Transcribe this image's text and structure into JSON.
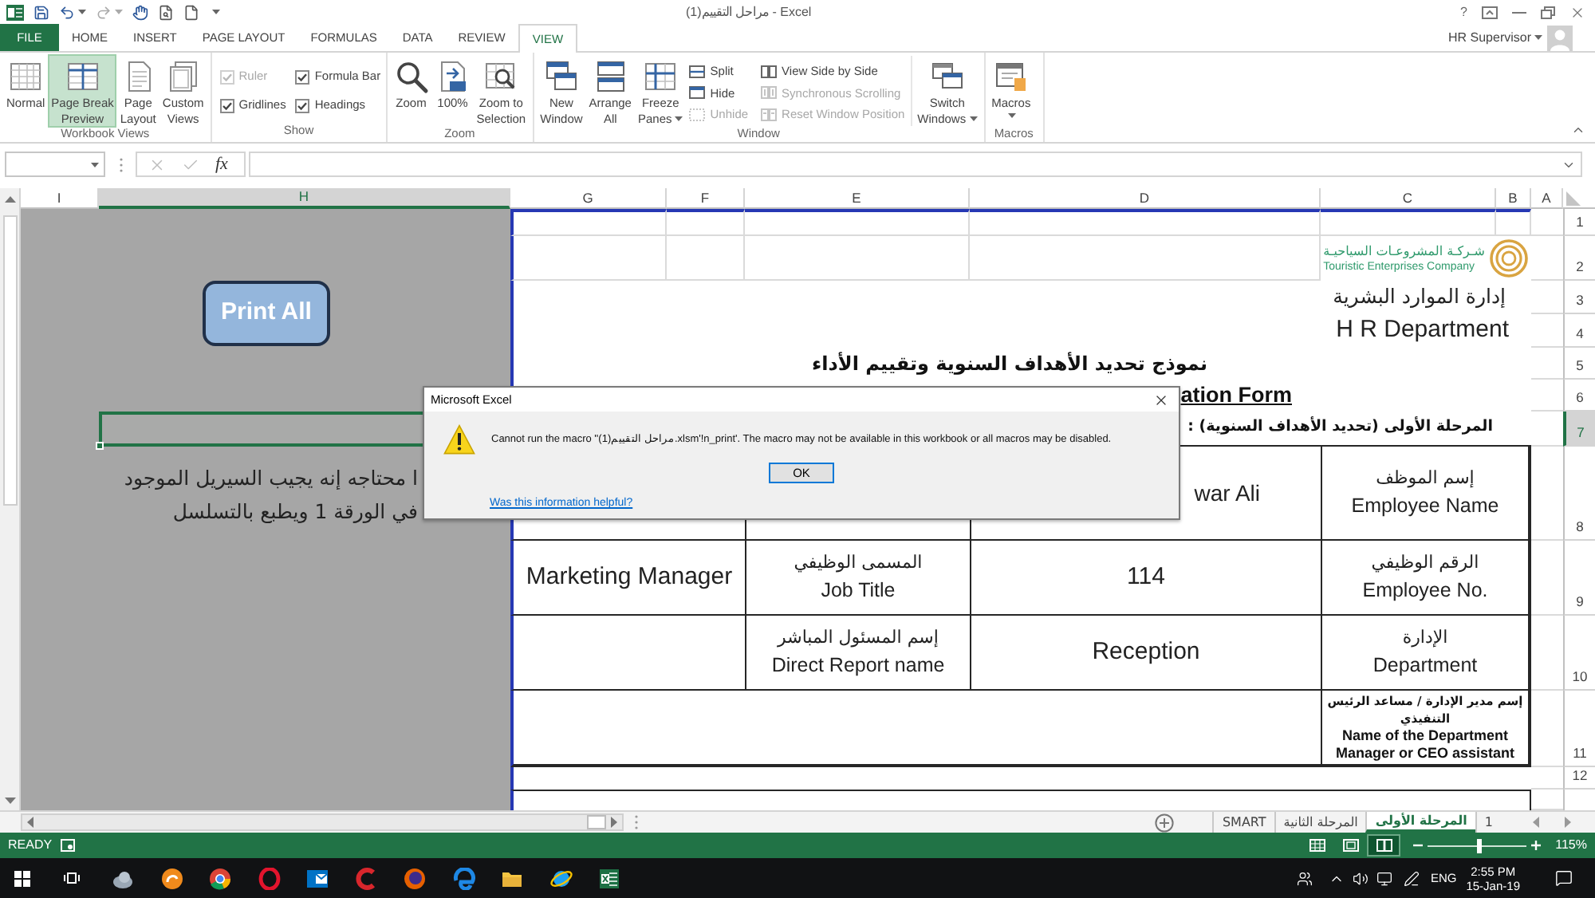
{
  "title_bar": {
    "title": "مراحل التقييم(1) - Excel",
    "help": "?"
  },
  "ribbon_tabs": [
    {
      "label": "FILE",
      "kind": "file",
      "selected": false
    },
    {
      "label": "HOME",
      "kind": "tab",
      "selected": false
    },
    {
      "label": "INSERT",
      "kind": "tab",
      "selected": false
    },
    {
      "label": "PAGE LAYOUT",
      "kind": "tab",
      "selected": false
    },
    {
      "label": "FORMULAS",
      "kind": "tab",
      "selected": false
    },
    {
      "label": "DATA",
      "kind": "tab",
      "selected": false
    },
    {
      "label": "REVIEW",
      "kind": "tab",
      "selected": false
    },
    {
      "label": "VIEW",
      "kind": "tab",
      "selected": true
    }
  ],
  "account": {
    "user": "HR Supervisor"
  },
  "ribbon": {
    "workbook_views": {
      "label": "Workbook Views",
      "buttons": [
        {
          "label": "Normal",
          "selected": false
        },
        {
          "label": "Page Break\nPreview",
          "selected": true
        },
        {
          "label": "Page\nLayout",
          "selected": false
        },
        {
          "label": "Custom\nViews",
          "selected": false
        }
      ]
    },
    "show": {
      "label": "Show",
      "options": [
        {
          "label": "Ruler",
          "checked": true,
          "disabled": true
        },
        {
          "label": "Formula Bar",
          "checked": true,
          "disabled": false
        },
        {
          "label": "Gridlines",
          "checked": true,
          "disabled": false
        },
        {
          "label": "Headings",
          "checked": true,
          "disabled": false
        }
      ]
    },
    "zoom": {
      "label": "Zoom",
      "buttons": [
        {
          "label": "Zoom"
        },
        {
          "label": "100%"
        },
        {
          "label": "Zoom to\nSelection"
        }
      ]
    },
    "window": {
      "label": "Window",
      "buttons": [
        {
          "label": "New\nWindow",
          "dropdown": false
        },
        {
          "label": "Arrange\nAll",
          "dropdown": false
        },
        {
          "label": "Freeze\nPanes",
          "dropdown": true
        }
      ],
      "small_buttons": [
        {
          "label": "Split",
          "disabled": false
        },
        {
          "label": "Hide",
          "disabled": false
        },
        {
          "label": "Unhide",
          "disabled": true
        },
        {
          "label": "View Side by Side",
          "disabled": false
        },
        {
          "label": "Synchronous Scrolling",
          "disabled": true
        },
        {
          "label": "Reset Window Position",
          "disabled": true
        }
      ],
      "switch_button": {
        "label": "Switch\nWindows",
        "dropdown": true
      }
    },
    "macros": {
      "label": "Macros",
      "buttons": [
        {
          "label": "Macros",
          "dropdown": true
        }
      ]
    }
  },
  "formula_bar": {
    "function_label": "fx"
  },
  "columns": [
    {
      "label": "I",
      "selected": false
    },
    {
      "label": "H",
      "selected": true
    },
    {
      "label": "G",
      "selected": false
    },
    {
      "label": "F",
      "selected": false
    },
    {
      "label": "E",
      "selected": false
    },
    {
      "label": "D",
      "selected": false
    },
    {
      "label": "C",
      "selected": false
    },
    {
      "label": "B",
      "selected": false
    },
    {
      "label": "A",
      "selected": false
    }
  ],
  "rows": [
    {
      "label": "1",
      "selected": false
    },
    {
      "label": "2",
      "selected": false
    },
    {
      "label": "3",
      "selected": false
    },
    {
      "label": "4",
      "selected": false
    },
    {
      "label": "5",
      "selected": false
    },
    {
      "label": "6",
      "selected": false
    },
    {
      "label": "7",
      "selected": true
    },
    {
      "label": "8",
      "selected": false
    },
    {
      "label": "9",
      "selected": false
    },
    {
      "label": "10",
      "selected": false
    },
    {
      "label": "11",
      "selected": false
    },
    {
      "label": "12",
      "selected": false
    }
  ],
  "sheet": {
    "print_all_button": "Print All",
    "note": "ا محتاجه إنه يجيب السيريل الموجود\nفي الورقة 1 ويطبع بالتسلسل",
    "logo": {
      "arabic": "شـركـة المشروعـات السياحيـة",
      "english": "Touristic Enterprises Company"
    },
    "department": {
      "arabic": "إدارة الموارد البشرية",
      "english": "H R Department"
    },
    "title": "نموذج تحديد الأهداف السنوية وتقييم الأداء",
    "subtitle": "ation Form",
    "form": {
      "stage": "المرحلة الأولى (تحديد الأهداف السنوية) :",
      "rows": [
        {
          "kind": "pair",
          "label": {
            "ar": "إسم الموظف",
            "en": "Employee Name"
          },
          "value": "war Ali"
        },
        {
          "kind": "double",
          "label": {
            "ar": "الرقم الوظيفي",
            "en": "Employee No."
          },
          "value": "114",
          "label_2": {
            "ar": "المسمى الوظيفي",
            "en": "Job Title"
          },
          "value_2": "Marketing Manager"
        },
        {
          "kind": "double",
          "label": {
            "ar": "الإدارة",
            "en": "Department"
          },
          "value": "Reception",
          "label_2": {
            "ar": "إسم المسئول المباشر",
            "en": "Direct Report name"
          }
        },
        {
          "kind": "wide",
          "label": {
            "ar": "إسم مدير الإدارة / مساعد الرئيس التنفيذي",
            "en": "Name of the Department Manager or CEO assistant"
          }
        }
      ]
    }
  },
  "dialog": {
    "title": "Microsoft Excel",
    "message": "Cannot run the macro ''مراحل التقييم(1).xlsm'!n_print'. The macro may not be available in this workbook or all macros may be disabled.",
    "button": "OK",
    "link": "Was this information helpful?"
  },
  "sheet_tabs": [
    {
      "label": "SMART",
      "selected": false
    },
    {
      "label": "المرحلة الثانية",
      "selected": false
    },
    {
      "label": "المرحلة الأولى",
      "selected": true
    },
    {
      "label": "1",
      "selected": false
    }
  ],
  "status_bar": {
    "status": "READY",
    "views": [
      {
        "selected": false
      },
      {
        "selected": false
      },
      {
        "selected": true
      }
    ],
    "zoom": {
      "level": 0.52,
      "reading": "115%"
    }
  },
  "taskbar": {
    "language": "ENG",
    "time": "2:55 PM",
    "date": "15-Jan-19"
  }
}
